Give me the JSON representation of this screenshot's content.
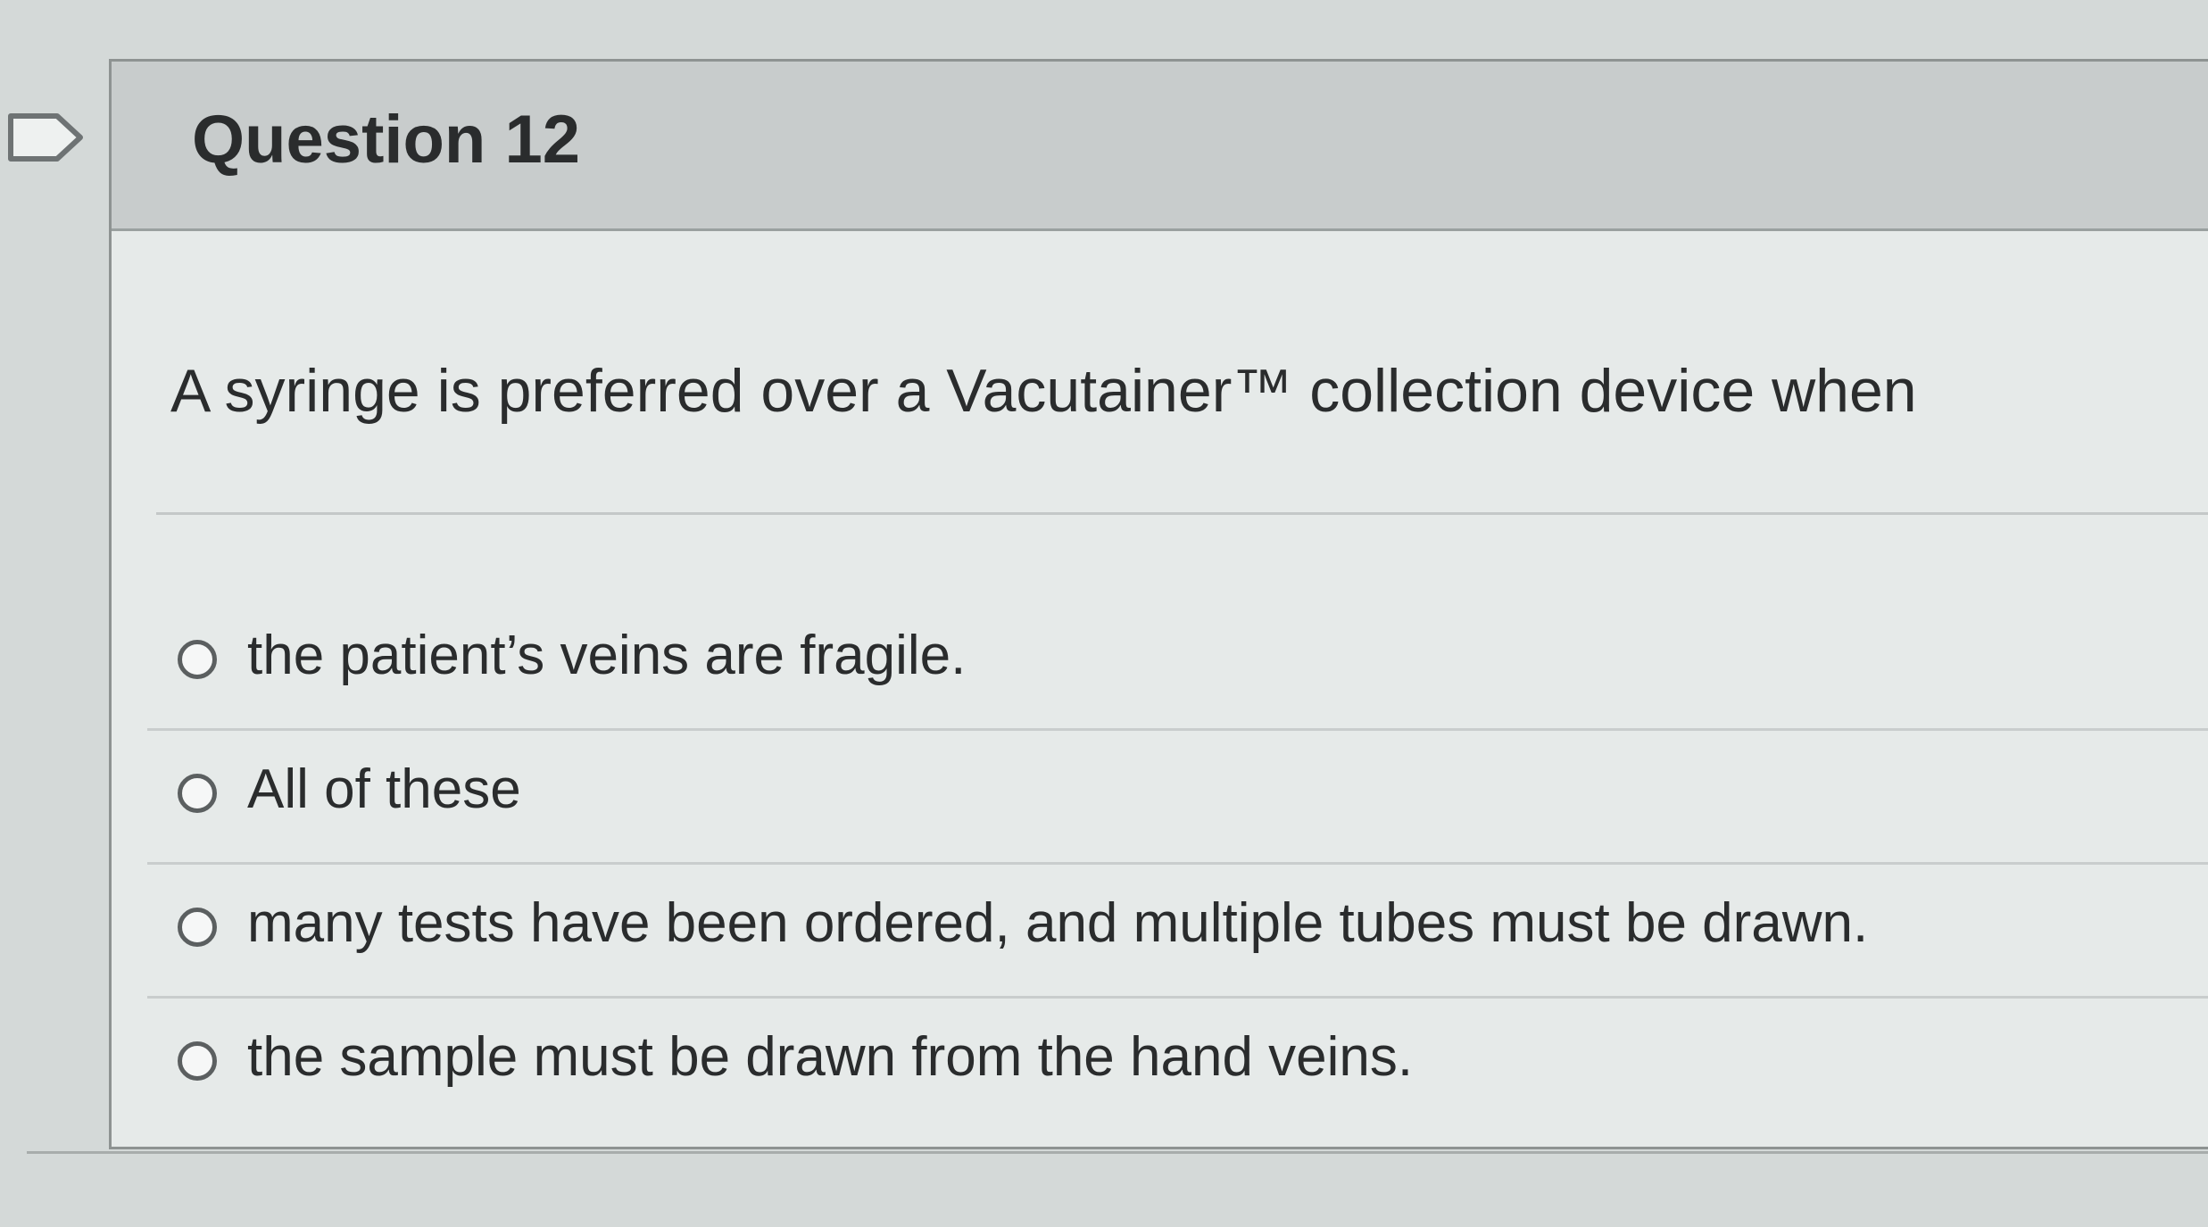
{
  "question": {
    "title": "Question 12",
    "text": "A syringe is preferred over a Vacutainer™ collection device when",
    "options": [
      {
        "label": "the patient’s veins are fragile."
      },
      {
        "label": "All of these"
      },
      {
        "label": "many tests have been ordered, and multiple tubes must be drawn."
      },
      {
        "label": "the sample must be drawn from the hand veins."
      }
    ]
  },
  "icons": {
    "flag": "flag-question-icon",
    "radio": "radio-unselected-icon"
  }
}
